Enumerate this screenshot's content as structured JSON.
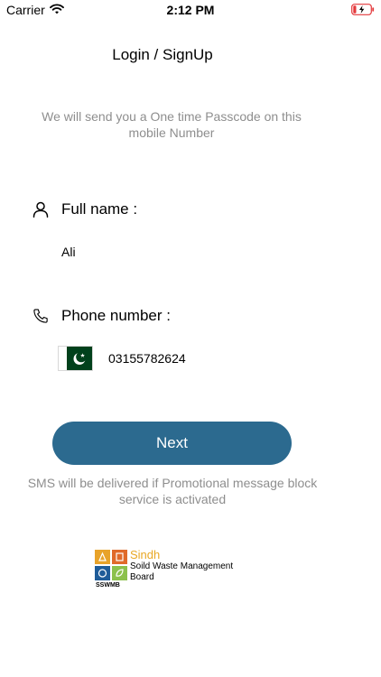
{
  "status_bar": {
    "carrier": "Carrier",
    "time": "2:12 PM",
    "battery_color": "#e4393c"
  },
  "title": "Login / SignUp",
  "otp_info": "We will send you a One time Passcode on this mobile Number",
  "name_field": {
    "icon": "person-icon",
    "label": "Full name :",
    "value": "Ali"
  },
  "phone_field": {
    "icon": "phone-icon",
    "label": "Phone number :",
    "country_flag": "pakistan-flag-icon",
    "value": "03155782624"
  },
  "next_button": {
    "label": "Next",
    "color": "#2c6a8f"
  },
  "sms_note": "SMS will be delivered if Promotional message block service is activated",
  "logo": {
    "name": "Sindh",
    "subtitle": "Soild Waste Management Board",
    "abbr": "SSWMB"
  }
}
